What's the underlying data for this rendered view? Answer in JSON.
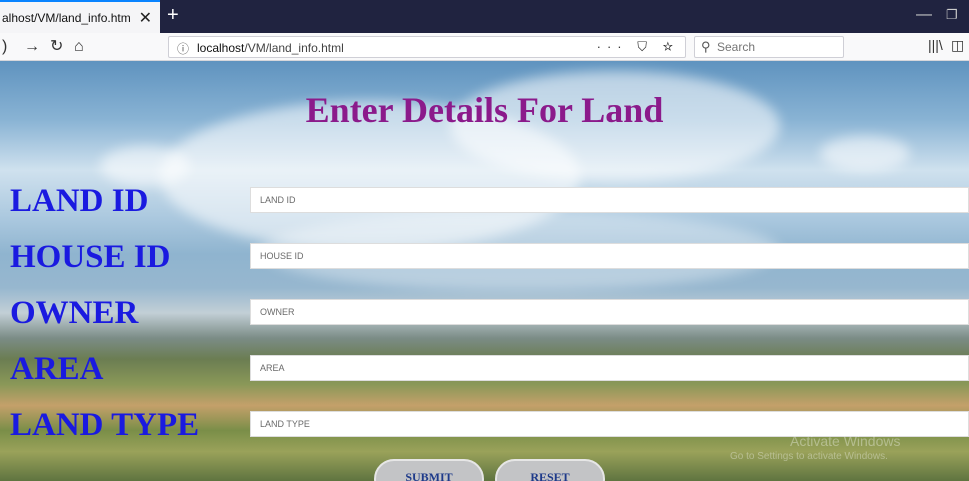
{
  "browser": {
    "tab_title": "alhost/VM/land_info.html",
    "tab_close_icon": "close-icon",
    "new_tab_icon": "plus-icon",
    "url_host": "localhost",
    "url_path": "/VM/land_info.html",
    "url_actions": "··· ⛉ ☆",
    "search_placeholder": "Search"
  },
  "page": {
    "title": "Enter Details For Land",
    "fields": [
      {
        "label": "LAND ID",
        "placeholder": "LAND ID",
        "value": ""
      },
      {
        "label": "HOUSE ID",
        "placeholder": "HOUSE ID",
        "value": ""
      },
      {
        "label": "OWNER",
        "placeholder": "OWNER",
        "value": ""
      },
      {
        "label": "AREA",
        "placeholder": "AREA",
        "value": ""
      },
      {
        "label": "LAND TYPE",
        "placeholder": "LAND TYPE",
        "value": ""
      }
    ],
    "submit_label": "SUBMIT",
    "reset_label": "RESET"
  },
  "watermark": {
    "line1": "Activate Windows",
    "line2": "Go to Settings to activate Windows."
  },
  "colors": {
    "title": "#8b1a8b",
    "labels": "#1a1ae0",
    "button_text": "#1e3a8a"
  }
}
